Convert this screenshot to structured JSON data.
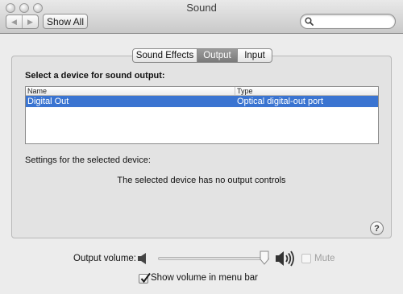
{
  "window": {
    "title": "Sound"
  },
  "toolbar": {
    "back_icon": "back-arrow-icon",
    "forward_icon": "forward-arrow-icon",
    "show_all_label": "Show All",
    "search_placeholder": "",
    "search_value": ""
  },
  "tabs": [
    {
      "label": "Sound Effects",
      "selected": false
    },
    {
      "label": "Output",
      "selected": true
    },
    {
      "label": "Input",
      "selected": false
    }
  ],
  "output": {
    "heading": "Select a device for sound output:",
    "table": {
      "columns": [
        "Name",
        "Type"
      ],
      "rows": [
        {
          "name": "Digital Out",
          "type": "Optical digital-out port",
          "selected": true
        }
      ]
    },
    "settings_label": "Settings for the selected device:",
    "no_controls_message": "The selected device has no output controls"
  },
  "volume": {
    "label": "Output volume:",
    "level_fraction": 0.96,
    "mute_label": "Mute",
    "mute_checked": false,
    "mute_enabled": false,
    "show_in_menu_bar_label": "Show volume in menu bar",
    "show_in_menu_bar_checked": true
  },
  "colors": {
    "selection": "#3a74d1",
    "selected_tab": "#8a8a8a",
    "window_background": "#ececec"
  }
}
